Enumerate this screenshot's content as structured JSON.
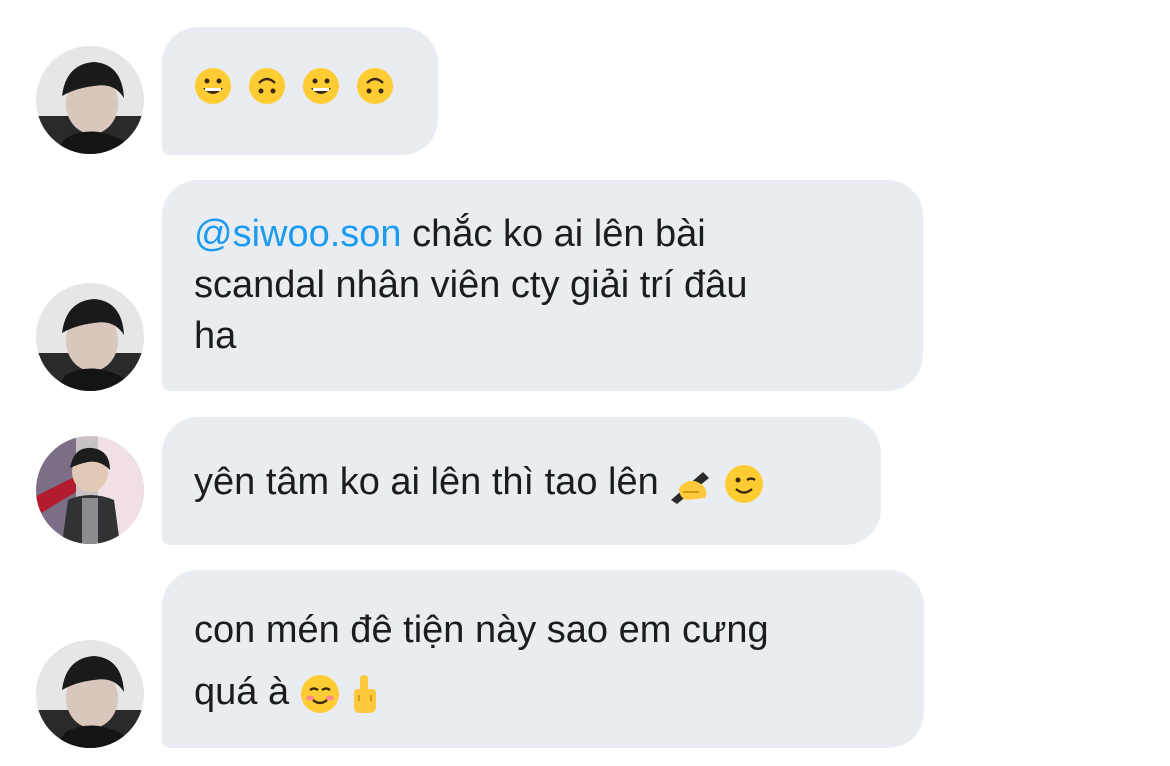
{
  "messages": [
    {
      "sender": "avatar-dark",
      "emojis": [
        "grinning-face",
        "upside-down-face",
        "grinning-face",
        "upside-down-face"
      ]
    },
    {
      "sender": "avatar-dark",
      "mention": "@siwoo.son",
      "line1": " chắc ko ai lên bài",
      "line2": "scandal nhân viên cty giải trí đâu",
      "line3": "ha"
    },
    {
      "sender": "avatar-award",
      "text": "yên tâm ko ai lên thì tao lên",
      "emojis": [
        "writing-hand",
        "winking-face"
      ]
    },
    {
      "sender": "avatar-dark",
      "line1": "con mén đê tiện này sao em cưng",
      "line2": "quá à",
      "emojis": [
        "smiling-face",
        "middle-finger"
      ]
    }
  ],
  "colors": {
    "bubble": "#e9edf1",
    "text": "#1c1c1e",
    "mention": "#1d9bf0"
  }
}
